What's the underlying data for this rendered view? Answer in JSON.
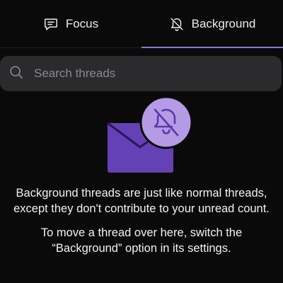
{
  "tabs": [
    {
      "label": "Focus",
      "icon": "chat-bubble-icon",
      "active": false
    },
    {
      "label": "Background",
      "icon": "bell-off-icon",
      "active": true
    }
  ],
  "accent_color": "#8e79d6",
  "search": {
    "placeholder": "Search threads",
    "value": ""
  },
  "empty_state": {
    "icon": "envelope-with-muted-bell",
    "paragraph1_line1": "Background threads are just like normal threads,",
    "paragraph1_line2": "except they don't contribute to your unread count.",
    "paragraph2_line1": "To move a thread over here, switch the",
    "paragraph2_line2": "“Background” option in its settings."
  }
}
